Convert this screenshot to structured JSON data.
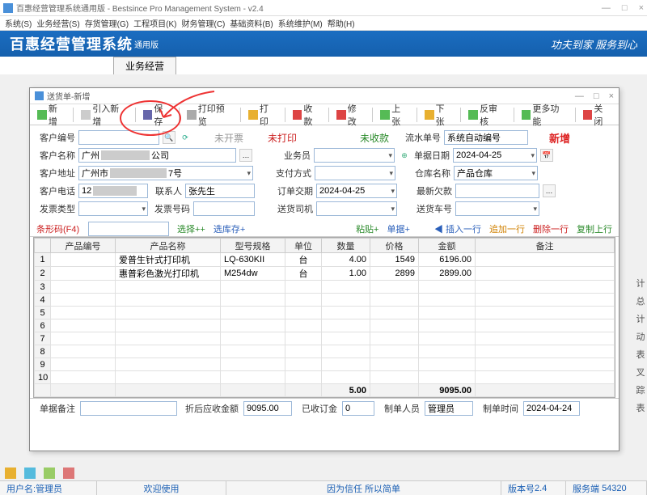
{
  "main_window": {
    "title": "百惠经营管理系统通用版 - Bestsince Pro Management System - v2.4",
    "menus": [
      "系统(S)",
      "业务经营(S)",
      "存货管理(G)",
      "工程项目(K)",
      "财务管理(C)",
      "基础资料(B)",
      "系统维护(M)",
      "帮助(H)"
    ],
    "brand": "百惠经营管理系统",
    "brand_sub": "通用版",
    "slogan": "功夫到家 服务到心",
    "tab": "业务经营"
  },
  "dialog": {
    "title": "送货单-新增",
    "toolbar": {
      "add": "新增",
      "import": "引入新增",
      "save": "保存",
      "preview": "打印预览",
      "print": "打印",
      "pay": "收款",
      "edit": "修改",
      "prev": "上张",
      "next": "下张",
      "audit": "反审核",
      "more": "更多功能",
      "close": "关闭"
    },
    "status": {
      "uninvoiced": "未开票",
      "unprinted": "未打印",
      "unpaid": "未收款",
      "mode": "新增"
    },
    "fields": {
      "customer_code_lbl": "客户编号",
      "customer_code": "",
      "serial_lbl": "流水单号",
      "serial": "系统自动编号",
      "customer_name_lbl": "客户名称",
      "customer_name": "广州",
      "customer_name_suffix": "公司",
      "salesman_lbl": "业务员",
      "salesman": "",
      "bill_date_lbl": "单据日期",
      "bill_date": "2024-04-25",
      "customer_addr_lbl": "客户地址",
      "customer_addr_a": "广州市",
      "customer_addr_b": "7号",
      "pay_method_lbl": "支付方式",
      "pay_method": "",
      "warehouse_lbl": "仓库名称",
      "warehouse": "产品仓库",
      "customer_tel_lbl": "客户电话",
      "customer_tel": "12",
      "contact_lbl": "联系人",
      "contact": "张先生",
      "delivery_date_lbl": "订单交期",
      "delivery_date": "2024-04-25",
      "last_debt_lbl": "最新欠款",
      "last_debt": "",
      "invoice_type_lbl": "发票类型",
      "invoice_type": "",
      "invoice_no_lbl": "发票号码",
      "invoice_no": "",
      "driver_lbl": "送货司机",
      "driver": "",
      "vehicle_lbl": "送货车号",
      "vehicle": "",
      "barcode_lbl": "条形码(F4)",
      "barcode": ""
    },
    "links": {
      "select": "选择++",
      "select_stock": "选库存+",
      "paste": "粘贴+",
      "single": "单据+",
      "insert": "◀ 插入一行",
      "append": "追加一行",
      "delete": "删除一行",
      "copy_up": "复制上行"
    },
    "grid": {
      "headers": [
        "产品编号",
        "产品名称",
        "型号规格",
        "单位",
        "数量",
        "价格",
        "金额",
        "备注"
      ],
      "rows": [
        {
          "n": 1,
          "name": "爱普生针式打印机",
          "model": "LQ-630KII",
          "unit": "台",
          "qty": "4.00",
          "price": "1549",
          "amount": "6196.00",
          "remark": ""
        },
        {
          "n": 2,
          "name": "惠普彩色激光打印机",
          "model": "M254dw",
          "unit": "台",
          "qty": "1.00",
          "price": "2899",
          "amount": "2899.00",
          "remark": ""
        }
      ],
      "emptyn": [
        3,
        4,
        5,
        6,
        7,
        8,
        9,
        10
      ],
      "sum_qty": "5.00",
      "sum_amount": "9095.00"
    },
    "footer": {
      "remark_lbl": "单据备注",
      "remark": "",
      "discount_lbl": "折后应收金额",
      "discount": "9095.00",
      "deposit_lbl": "已收订金",
      "deposit": "0",
      "maker_lbl": "制单人员",
      "maker": "管理员",
      "maketime_lbl": "制单时间",
      "maketime": "2024-04-24"
    }
  },
  "side_chars": [
    "计",
    "总",
    "计",
    "动",
    "表",
    "叉",
    "踪",
    "表"
  ],
  "statusbar": {
    "user_lbl": "用户名:",
    "user": "管理员",
    "welcome": "欢迎使用",
    "motto": "因为信任 所以简单",
    "ver_lbl": "版本号",
    "ver": "2.4",
    "server_lbl": "服务端",
    "server": "54320"
  }
}
